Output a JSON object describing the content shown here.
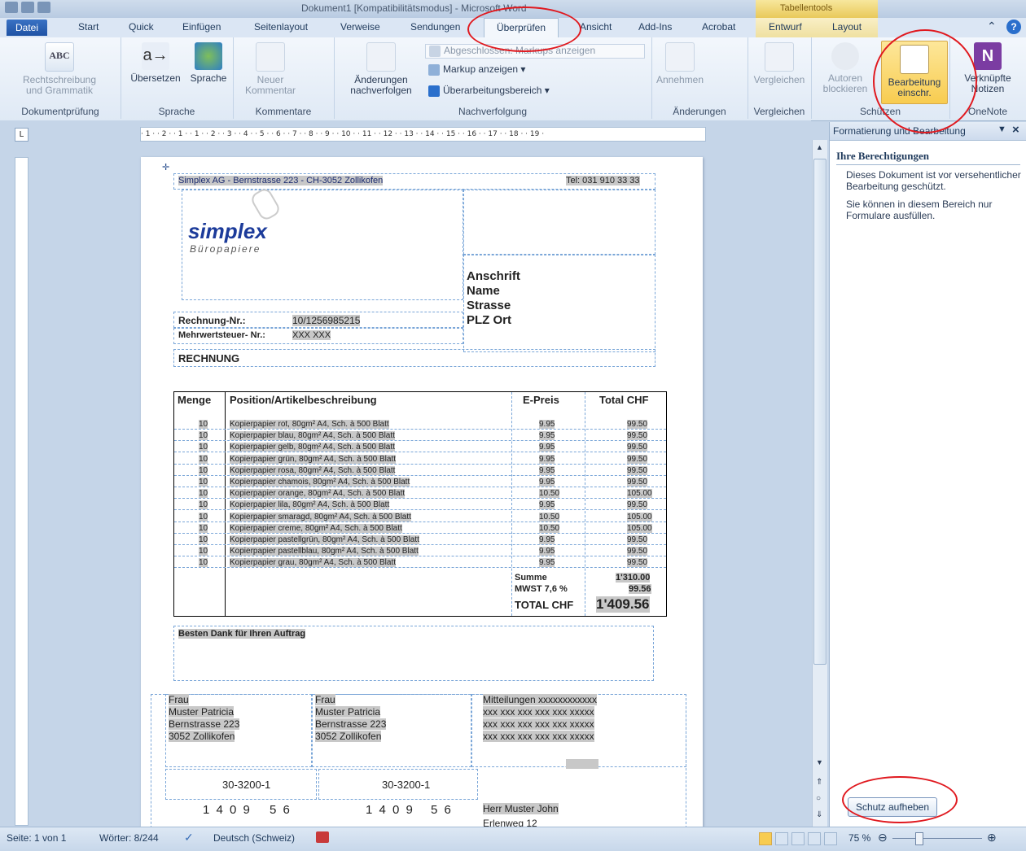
{
  "window": {
    "title": "Dokument1 [Kompatibilitätsmodus] - Microsoft Word",
    "context_band": "Tabellentools"
  },
  "tabs": [
    "Datei",
    "Start",
    "Quick",
    "Einfügen",
    "Seitenlayout",
    "Verweise",
    "Sendungen",
    "Überprüfen",
    "Ansicht",
    "Add-Ins",
    "Acrobat",
    "Entwurf",
    "Layout"
  ],
  "ribbon": {
    "doc": {
      "spell1": "Rechtschreibung",
      "spell2": "und Grammatik",
      "label": "Dokumentprüfung"
    },
    "sprache": {
      "translate": "Übersetzen",
      "language": "Sprache",
      "label": "Sprache"
    },
    "komm": {
      "new1": "Neuer",
      "new2": "Kommentar",
      "label": "Kommentare"
    },
    "nach": {
      "track1": "Änderungen",
      "track2": "nachverfolgen",
      "markup_final": "Abgeschlossen: Markups anzeigen",
      "show_markup": "Markup anzeigen",
      "review_pane": "Überarbeitungsbereich",
      "label": "Nachverfolgung"
    },
    "aend": {
      "accept": "Annehmen",
      "label": "Änderungen"
    },
    "verg": {
      "compare": "Vergleichen",
      "label": "Vergleichen"
    },
    "schutz": {
      "block1": "Autoren",
      "block2": "blockieren",
      "restrict1": "Bearbeitung",
      "restrict2": "einschr.",
      "label": "Schützen"
    },
    "onenote": {
      "linked1": "Verknüpfte",
      "linked2": "Notizen",
      "label": "OneNote"
    }
  },
  "ruler": "· 1 · · 2 · · 1 · · 1 · · 2 · · 3 · · 4 · · 5 · · 6 · · 7 · · 8 · · 9 · · 10 · · 11 · · 12 · · 13 · · 14 · · 15 · · 16 · · 17 · · 18 · · 19 ·",
  "document": {
    "header_left": "Simplex AG - Bernstrasse 223 - CH-3052 Zollikofen",
    "header_tel": "Tel: 031 910 33 33",
    "logo": "simplex",
    "logo_sub": "Büropapiere",
    "address": [
      "Anschrift",
      "Name",
      "Strasse",
      "PLZ Ort"
    ],
    "rechnung_nr_label": "Rechnung-Nr.:",
    "rechnung_nr": "10/1256985215",
    "mwst_label": "Mehrwertsteuer- Nr.:",
    "mwst_nr": "XXX XXX",
    "rechnung": "RECHNUNG",
    "table_headers": {
      "menge": "Menge",
      "position": "Position/Artikelbeschreibung",
      "preis": "E-Preis",
      "total": "Total CHF"
    },
    "items": [
      {
        "qty": "10",
        "desc": "Kopierpapier rot, 80gm² A4, Sch. à 500 Blatt",
        "price": "9.95",
        "total": "99.50"
      },
      {
        "qty": "10",
        "desc": "Kopierpapier blau, 80gm² A4, Sch. à 500 Blatt",
        "price": "9.95",
        "total": "99.50"
      },
      {
        "qty": "10",
        "desc": "Kopierpapier gelb, 80gm² A4, Sch. à 500 Blatt",
        "price": "9.95",
        "total": "99.50"
      },
      {
        "qty": "10",
        "desc": "Kopierpapier grün, 80gm² A4, Sch. à 500 Blatt",
        "price": "9.95",
        "total": "99.50"
      },
      {
        "qty": "10",
        "desc": "Kopierpapier rosa, 80gm² A4, Sch. à 500 Blatt",
        "price": "9.95",
        "total": "99.50"
      },
      {
        "qty": "10",
        "desc": "Kopierpapier chamois, 80gm² A4, Sch. à 500 Blatt",
        "price": "9.95",
        "total": "99.50"
      },
      {
        "qty": "10",
        "desc": "Kopierpapier orange, 80gm² A4, Sch. à 500 Blatt",
        "price": "10.50",
        "total": "105.00"
      },
      {
        "qty": "10",
        "desc": "Kopierpapier lila, 80gm² A4, Sch. à 500 Blatt",
        "price": "9.95",
        "total": "99.50"
      },
      {
        "qty": "10",
        "desc": "Kopierpapier smaragd, 80gm² A4, Sch. à 500 Blatt",
        "price": "10.50",
        "total": "105.00"
      },
      {
        "qty": "10",
        "desc": "Kopierpapier creme, 80gm² A4, Sch. à 500 Blatt",
        "price": "10.50",
        "total": "105.00"
      },
      {
        "qty": "10",
        "desc": "Kopierpapier pastellgrün, 80gm² A4, Sch. à 500 Blatt",
        "price": "9.95",
        "total": "99.50"
      },
      {
        "qty": "10",
        "desc": "Kopierpapier pastellblau, 80gm² A4, Sch. à 500 Blatt",
        "price": "9.95",
        "total": "99.50"
      },
      {
        "qty": "10",
        "desc": "Kopierpapier grau, 80gm² A4, Sch. à 500 Blatt",
        "price": "9.95",
        "total": "99.50"
      }
    ],
    "summe_label": "Summe",
    "summe": "1'310.00",
    "mwst_rate_label": "MWST 7,6 %",
    "mwst_amount": "99.56",
    "total_label": "TOTAL CHF",
    "total": "1'409.56",
    "thanks": "Besten Dank für Ihren Auftrag",
    "slip_left": [
      "Frau",
      "Muster Patricia",
      "Bernstrasse  223",
      "3052 Zollikofen"
    ],
    "slip_mid": [
      "Frau",
      "Muster Patricia",
      "Bernstrasse  223",
      "3052 Zollikofen"
    ],
    "slip_right": [
      "Mitteilungen xxxxxxxxxxxx",
      "xxx xxx xxx xxx xxx xxxxx",
      "xxx xxx xxx xxx xxx xxxxx",
      "xxx xxx xxx xxx xxx xxxxx"
    ],
    "account": "30-3200-1",
    "amount_digits": "1 4 0 9",
    "amount_cents": "5 6",
    "recipient": "Herr Muster John",
    "recipient_street": "Erlenweg 12"
  },
  "pane": {
    "title": "Formatierung und Bearbeitung",
    "heading": "Ihre Berechtigungen",
    "text1": "Dieses Dokument ist vor versehentlicher Bearbeitung geschützt.",
    "text2": "Sie können in diesem Bereich nur Formulare ausfüllen.",
    "button": "Schutz aufheben"
  },
  "status": {
    "page": "Seite: 1 von 1",
    "words": "Wörter: 8/244",
    "lang": "Deutsch (Schweiz)",
    "zoom": "75 %"
  },
  "colors": {
    "accent": "#1f53a4",
    "highlight": "#f8cc50",
    "annotation": "#e0191f",
    "field_shade": "#c8c8c8"
  }
}
